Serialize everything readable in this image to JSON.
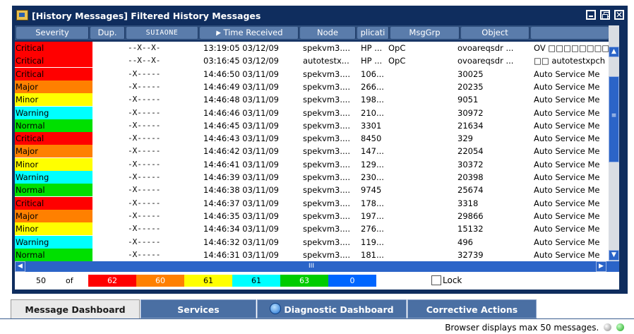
{
  "window": {
    "title": "[History Messages] Filtered History Messages",
    "buttons": {
      "minimize": "minimize",
      "restore": "restore",
      "close": "✕"
    }
  },
  "columns": [
    "Severity",
    "Dup.",
    "SUIAONE",
    "Time Received",
    "Node",
    "plicati",
    "MsgGrp",
    "Object"
  ],
  "rows": [
    {
      "severity": "Critical",
      "flags": "--X--X-",
      "time": "13:19:05 03/12/09",
      "node": "spekvm3....",
      "app": "HP ...",
      "msggrp": "OpC",
      "object": "ovoareqsdr ...",
      "desc": "OV □□□□□□□□"
    },
    {
      "severity": "Critical",
      "flags": "--X--X-",
      "time": "03:16:45 03/12/09",
      "node": "autotestx...",
      "app": "HP ...",
      "msggrp": "OpC",
      "object": "ovoareqsdr ...",
      "desc": "□□ autotestxpch"
    },
    {
      "severity": "Critical",
      "flags": "-X-----",
      "time": "14:46:50 03/11/09",
      "node": "spekvm3....",
      "app": "106...",
      "msggrp": "",
      "object": "30025",
      "desc": "Auto Service Me"
    },
    {
      "severity": "Major",
      "flags": "-X-----",
      "time": "14:46:49 03/11/09",
      "node": "spekvm3....",
      "app": "266...",
      "msggrp": "",
      "object": "20235",
      "desc": "Auto Service Me"
    },
    {
      "severity": "Minor",
      "flags": "-X-----",
      "time": "14:46:48 03/11/09",
      "node": "spekvm3....",
      "app": "198...",
      "msggrp": "",
      "object": "9051",
      "desc": "Auto Service Me"
    },
    {
      "severity": "Warning",
      "flags": "-X-----",
      "time": "14:46:46 03/11/09",
      "node": "spekvm3....",
      "app": "210...",
      "msggrp": "",
      "object": "30972",
      "desc": "Auto Service Me"
    },
    {
      "severity": "Normal",
      "flags": "-X-----",
      "time": "14:46:45 03/11/09",
      "node": "spekvm3....",
      "app": "3301",
      "msggrp": "",
      "object": "21634",
      "desc": "Auto Service Me"
    },
    {
      "severity": "Critical",
      "flags": "-X-----",
      "time": "14:46:43 03/11/09",
      "node": "spekvm3....",
      "app": "8450",
      "msggrp": "",
      "object": "329",
      "desc": "Auto Service Me"
    },
    {
      "severity": "Major",
      "flags": "-X-----",
      "time": "14:46:42 03/11/09",
      "node": "spekvm3....",
      "app": "147...",
      "msggrp": "",
      "object": "22054",
      "desc": "Auto Service Me"
    },
    {
      "severity": "Minor",
      "flags": "-X-----",
      "time": "14:46:41 03/11/09",
      "node": "spekvm3....",
      "app": "129...",
      "msggrp": "",
      "object": "30372",
      "desc": "Auto Service Me"
    },
    {
      "severity": "Warning",
      "flags": "-X-----",
      "time": "14:46:39 03/11/09",
      "node": "spekvm3....",
      "app": "230...",
      "msggrp": "",
      "object": "20398",
      "desc": "Auto Service Me"
    },
    {
      "severity": "Normal",
      "flags": "-X-----",
      "time": "14:46:38 03/11/09",
      "node": "spekvm3....",
      "app": "9745",
      "msggrp": "",
      "object": "25674",
      "desc": "Auto Service Me"
    },
    {
      "severity": "Critical",
      "flags": "-X-----",
      "time": "14:46:37 03/11/09",
      "node": "spekvm3....",
      "app": "178...",
      "msggrp": "",
      "object": "3318",
      "desc": "Auto Service Me"
    },
    {
      "severity": "Major",
      "flags": "-X-----",
      "time": "14:46:35 03/11/09",
      "node": "spekvm3....",
      "app": "197...",
      "msggrp": "",
      "object": "29866",
      "desc": "Auto Service Me"
    },
    {
      "severity": "Minor",
      "flags": "-X-----",
      "time": "14:46:34 03/11/09",
      "node": "spekvm3....",
      "app": "276...",
      "msggrp": "",
      "object": "15132",
      "desc": "Auto Service Me"
    },
    {
      "severity": "Warning",
      "flags": "-X-----",
      "time": "14:46:32 03/11/09",
      "node": "spekvm3....",
      "app": "119...",
      "msggrp": "",
      "object": "496",
      "desc": "Auto Service Me"
    },
    {
      "severity": "Normal",
      "flags": "-X-----",
      "time": "14:46:31 03/11/09",
      "node": "spekvm3....",
      "app": "181...",
      "msggrp": "",
      "object": "32739",
      "desc": "Auto Service Me"
    }
  ],
  "severity_colors": {
    "Critical": "#ff0000",
    "Major": "#ff8000",
    "Minor": "#ffff00",
    "Warning": "#00ffff",
    "Normal": "#00e000"
  },
  "scrollbar": {
    "up": "▲",
    "down": "▼",
    "left": "◀",
    "right": "▶",
    "grip_v": "≡",
    "grip_h": "III"
  },
  "footer": {
    "total": "50",
    "of": "of",
    "counts": [
      {
        "value": "62",
        "color": "#ff0000"
      },
      {
        "value": "60",
        "color": "#ff8000"
      },
      {
        "value": "61",
        "color": "#ffff00"
      },
      {
        "value": "61",
        "color": "#00ffff"
      },
      {
        "value": "63",
        "color": "#00cc00"
      },
      {
        "value": "0",
        "color": "#0066ff"
      }
    ],
    "lock_label": "Lock"
  },
  "tabs": [
    {
      "label": "Message Dashboard",
      "active": true
    },
    {
      "label": "Services",
      "active": false
    },
    {
      "label": "Diagnostic Dashboard",
      "active": false,
      "icon": "globe-icon"
    },
    {
      "label": "Corrective Actions",
      "active": false
    }
  ],
  "status": {
    "text": "Browser displays max 50 messages."
  }
}
